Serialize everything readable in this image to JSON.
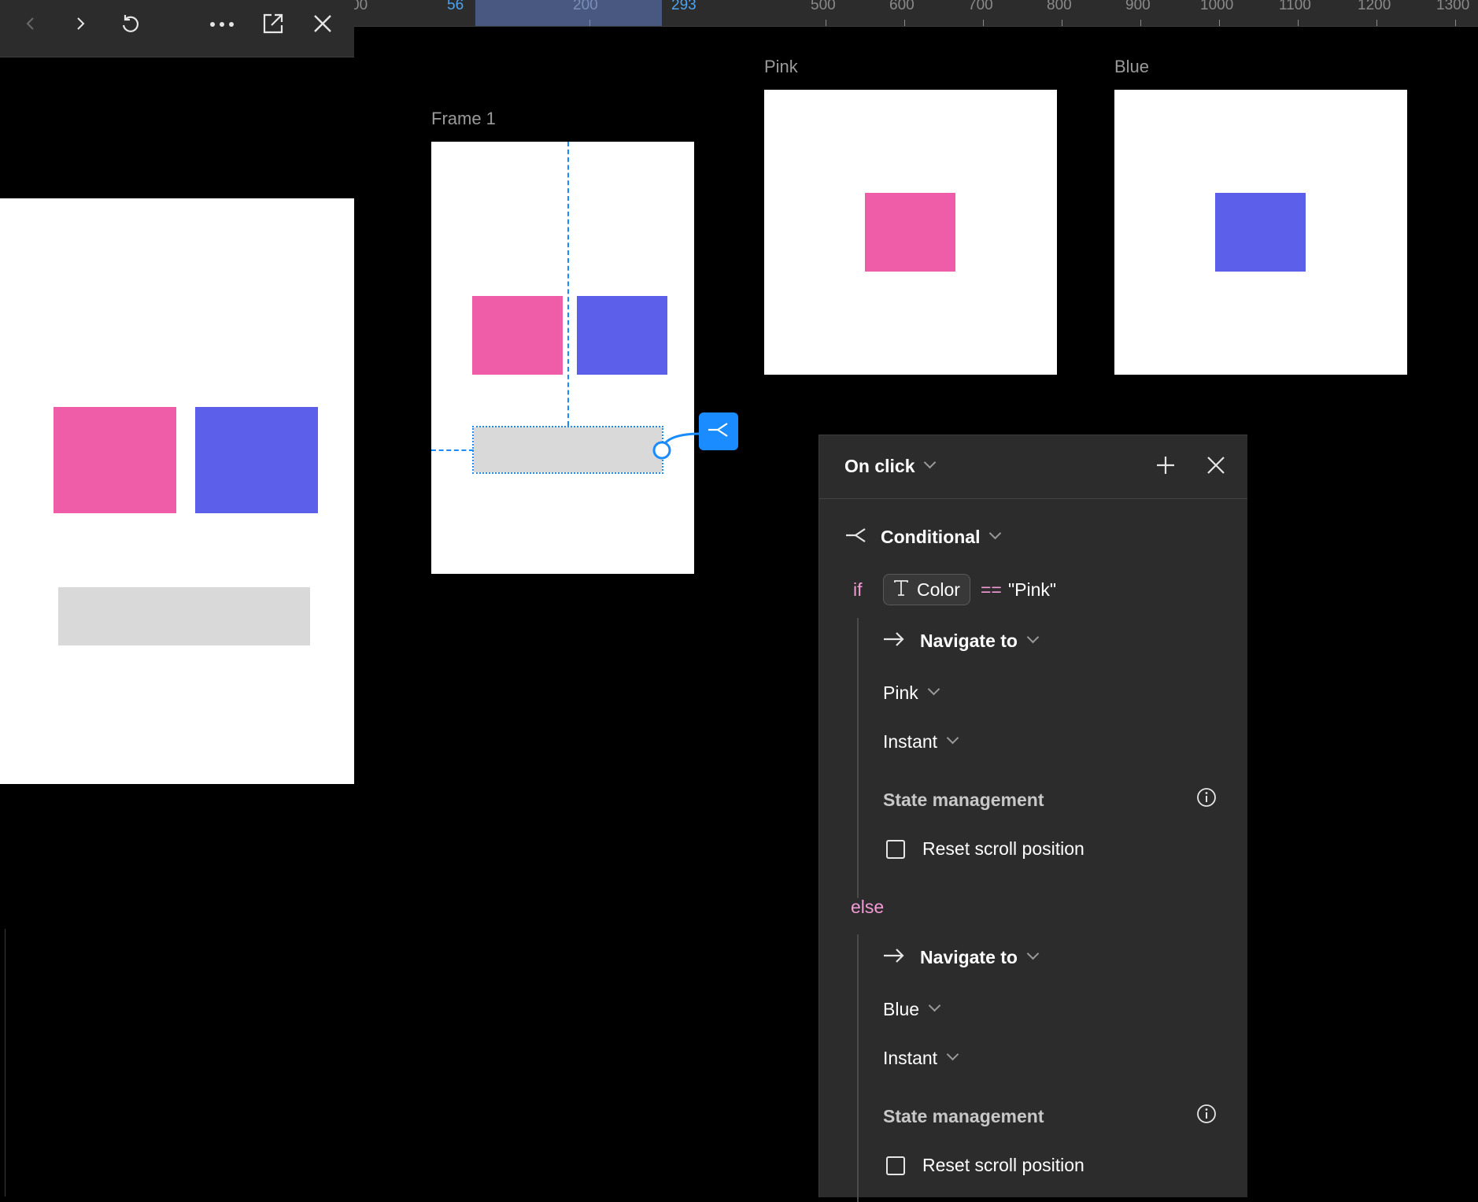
{
  "ruler": {
    "ticks": [
      "00",
      "56",
      "200",
      "293",
      "500",
      "600",
      "700",
      "800",
      "900",
      "1000",
      "1100",
      "1200",
      "1300"
    ],
    "highlighted": [
      "56",
      "293"
    ]
  },
  "preview_toolbar": {
    "icons": [
      "back-icon",
      "forward-icon",
      "restart-icon",
      "more-icon",
      "open-external-icon",
      "close-icon"
    ]
  },
  "canvas": {
    "frame1_label": "Frame 1",
    "pink_label": "Pink",
    "blue_label": "Blue"
  },
  "colors": {
    "pink": "#ef5ca8",
    "blue": "#5b5fe9",
    "accent": "#1a8cff",
    "keyword": "#f29bd6"
  },
  "panel": {
    "trigger": "On click",
    "action": "Conditional",
    "if_keyword": "if",
    "variable": "Color",
    "operator": "==",
    "value": "\"Pink\"",
    "else_keyword": "else",
    "if_branch": {
      "action": "Navigate to",
      "destination": "Pink",
      "animation": "Instant",
      "section": "State management",
      "checkbox_label": "Reset scroll position"
    },
    "else_branch": {
      "action": "Navigate to",
      "destination": "Blue",
      "animation": "Instant",
      "section": "State management",
      "checkbox_label": "Reset scroll position"
    }
  }
}
